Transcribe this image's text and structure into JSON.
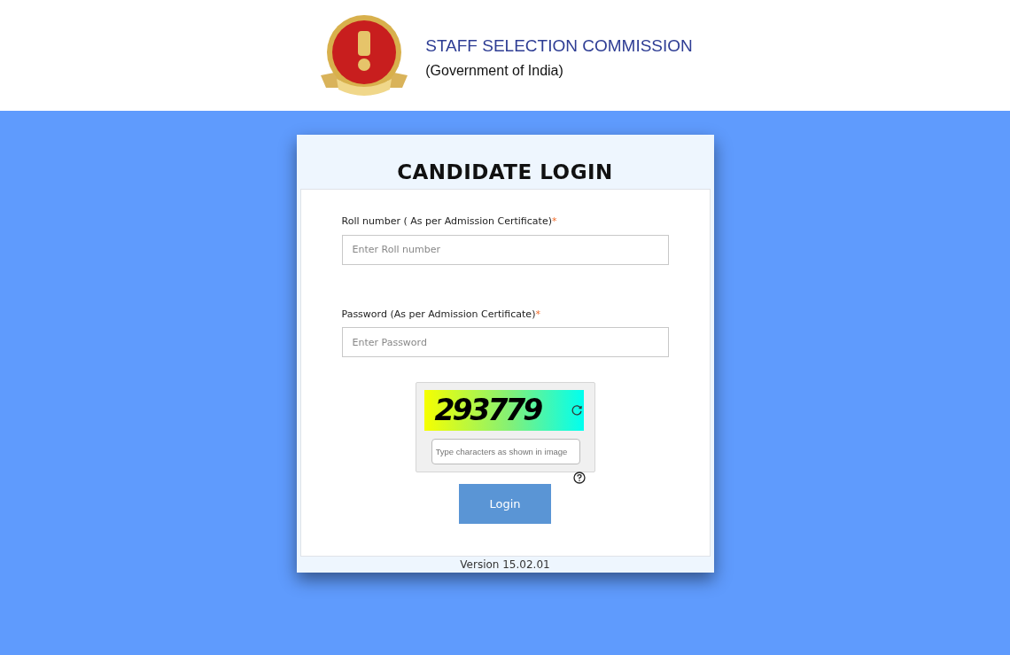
{
  "header": {
    "title": "STAFF SELECTION COMMISSION",
    "subtitle": "(Government of India)"
  },
  "login": {
    "title": "CANDIDATE LOGIN",
    "fields": [
      {
        "label": "Roll number ( As per Admission Certificate)",
        "required_mark": "*",
        "placeholder": "Enter Roll number"
      },
      {
        "label": "Password (As per Admission Certificate)",
        "required_mark": "*",
        "placeholder": "Enter Password"
      }
    ],
    "captcha": {
      "code": "293779",
      "placeholder": "Type characters as shown in image"
    },
    "button": "Login",
    "version": "Version 15.02.01"
  }
}
